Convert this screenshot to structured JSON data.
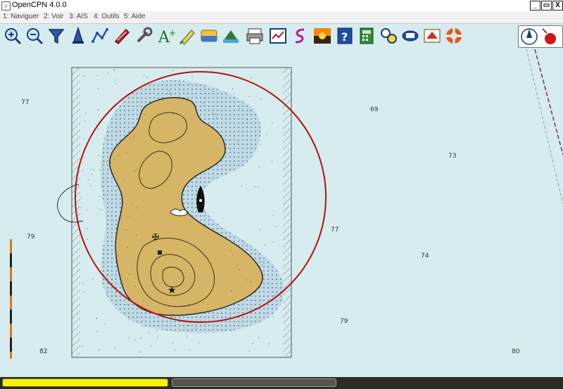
{
  "window": {
    "title": "OpenCPN 4.0.0",
    "icon_name": "opencpn-app-icon",
    "controls": [
      "_",
      "▭",
      "X"
    ]
  },
  "menu": [
    {
      "label": "1: Naviguer"
    },
    {
      "label": "2: Voir"
    },
    {
      "label": "3: AIS"
    },
    {
      "label": "4: Outils"
    },
    {
      "label": "5: Aide"
    }
  ],
  "toolbar": {
    "tools": [
      "zoom-in-icon",
      "zoom-out-icon",
      "quilt-filter-icon",
      "boat-follow-icon",
      "route-icon",
      "tracking-icon",
      "options-wrench-icon",
      "text-tool-icon",
      "pencil-icon",
      "tide-current-icon",
      "chart-layers-icon",
      "print-icon",
      "route-manager-icon",
      "track-icon",
      "sunset-color-icon",
      "help-icon",
      "calculator-icon",
      "dashboard-icon",
      "sat-icon",
      "gpx-export-icon",
      "lifebuoy-icon"
    ]
  },
  "chart": {
    "outside_soundings": [
      "77",
      "69",
      "73",
      "77",
      "74",
      "79",
      "79",
      "82",
      "80"
    ],
    "colors": {
      "sea": "#d6ecef",
      "land": "#d7b566",
      "range_ring": "#b51212",
      "soundings": "#333333",
      "route_line": "#8c2855"
    }
  },
  "status": {
    "progress_primary": 1.0,
    "progress_secondary": 1.0
  }
}
